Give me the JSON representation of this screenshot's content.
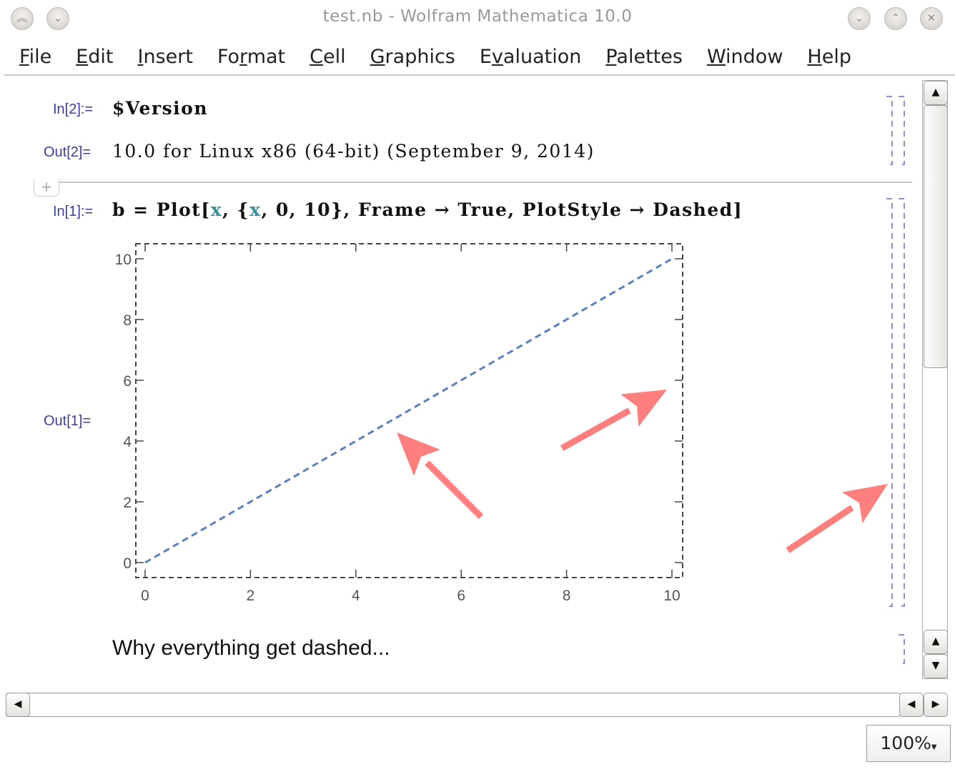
{
  "window": {
    "title": "test.nb - Wolfram Mathematica 10.0"
  },
  "menu": [
    {
      "pre": "",
      "u": "F",
      "post": "ile"
    },
    {
      "pre": "",
      "u": "E",
      "post": "dit"
    },
    {
      "pre": "",
      "u": "I",
      "post": "nsert"
    },
    {
      "pre": "Fo",
      "u": "r",
      "post": "mat"
    },
    {
      "pre": "",
      "u": "C",
      "post": "ell"
    },
    {
      "pre": "",
      "u": "G",
      "post": "raphics"
    },
    {
      "pre": "E",
      "u": "v",
      "post": "aluation"
    },
    {
      "pre": "",
      "u": "P",
      "post": "alettes"
    },
    {
      "pre": "",
      "u": "W",
      "post": "indow"
    },
    {
      "pre": "",
      "u": "H",
      "post": "elp"
    }
  ],
  "cells": {
    "in2_label": "In[2]:=",
    "in2_code": "$Version",
    "out2_label": "Out[2]=",
    "out2_text": "10.0 for Linux x86 (64-bit) (September 9, 2014)",
    "in1_label": "In[1]:=",
    "in1_code": {
      "a": "b = Plot[",
      "v1": "x",
      ",b": ", {",
      "v2": "x",
      "c": ", 0, 10}, Frame → True, PlotStyle → Dashed]"
    },
    "out1_label": "Out[1]=",
    "text_cell": "Why everything get dashed..."
  },
  "chart_data": {
    "type": "line",
    "function": "y = x",
    "x": [
      0,
      10
    ],
    "y": [
      0,
      10
    ],
    "xlim": [
      0,
      10
    ],
    "ylim": [
      0,
      10
    ],
    "xticks": [
      "0",
      "2",
      "4",
      "6",
      "8",
      "10"
    ],
    "yticks": [
      "0",
      "2",
      "4",
      "6",
      "8",
      "10"
    ],
    "line_style": "dashed",
    "line_color": "#5b7fbf",
    "frame": true,
    "grid": false
  },
  "annotations": {
    "arrow_color": "#ff7f7f",
    "count": 3
  },
  "status": {
    "zoom": "100%"
  }
}
